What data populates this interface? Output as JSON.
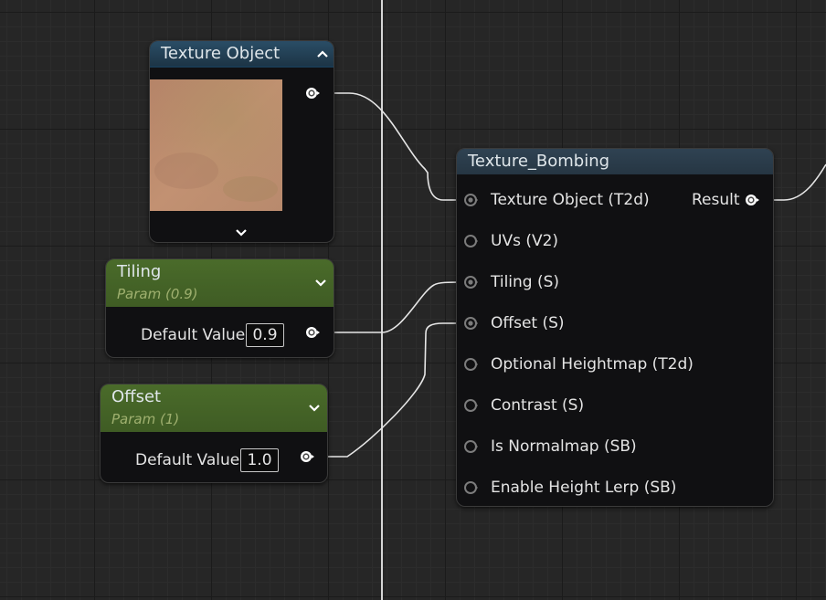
{
  "texture_object_node": {
    "title": "Texture Object",
    "collapse_icon": "chevron-up-icon",
    "expand_icon": "chevron-down-icon"
  },
  "tiling_node": {
    "title": "Tiling",
    "subtitle": "Param (0.9)",
    "value_label": "Default Value",
    "value": "0.9"
  },
  "offset_node": {
    "title": "Offset",
    "subtitle": "Param (1)",
    "value_label": "Default Value",
    "value": "1.0"
  },
  "bombing_node": {
    "title": "Texture_Bombing",
    "inputs": [
      "Texture Object (T2d)",
      "UVs (V2)",
      "Tiling (S)",
      "Offset (S)",
      "Optional Heightmap (T2d)",
      "Contrast (S)",
      "Is Normalmap (SB)",
      "Enable Height Lerp (SB)"
    ],
    "output": "Result"
  },
  "colors": {
    "canvas": "#262626",
    "header_blue": "#234158",
    "header_green": "#466628",
    "wire": "#e8e8e8"
  }
}
